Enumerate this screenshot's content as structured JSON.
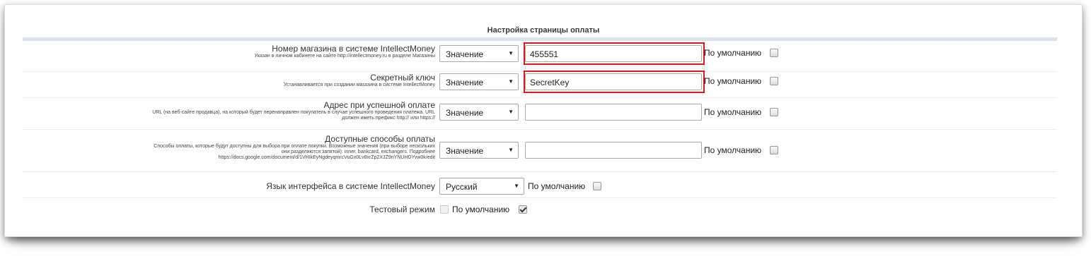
{
  "section": {
    "title": "Настройка страницы оплаты"
  },
  "rows": {
    "shop_id": {
      "label": "Номер магазина в системе IntellectMoney",
      "description": "Указан в личном кабинете на сайте http://intellectmoney.ru в разделе Магазины",
      "select_value": "Значение",
      "input_value": "455551",
      "default_label": "По умолчанию",
      "default_checked": false
    },
    "secret_key": {
      "label": "Секретный ключ",
      "description": "Устанавливается при создании магазина в системе IntellectMoney",
      "select_value": "Значение",
      "input_value": "SecretKey",
      "default_label": "По умолчанию",
      "default_checked": false
    },
    "success_url": {
      "label": "Адрес при успешной оплате",
      "description_lines": [
        "URL (на веб-сайте продавца), на который будет перенаправлен покупатель в случае успешного проведения платежа. URL",
        "должен иметь префикс http:// или https://"
      ],
      "select_value": "Значение",
      "input_value": "",
      "default_label": "По умолчанию",
      "default_checked": false
    },
    "payment_methods": {
      "label": "Доступные способы оплаты",
      "description_lines": [
        "Способы оплаты, которые будут доступны для выбора при оплате покупки. Возможные значения (при выборе нескольких",
        "они разделяются запятой): inner, bankcard, exchangers. Подробнее",
        "https://docs.google.com/document/d/1VHIkEyNgdeyqmrcVuGx0Lv8xrZp2XJZ9nYNUHDYvw0k/edit"
      ],
      "select_value": "Значение",
      "input_value": "",
      "default_label": "По умолчанию",
      "default_checked": false
    },
    "language": {
      "label": "Язык интерфейса в системе IntellectMoney",
      "select_value": "Русский",
      "default_label": "По умолчанию",
      "default_checked": false
    },
    "test_mode": {
      "label": "Тестовый режим",
      "checked": false,
      "default_label": "По умолчанию",
      "default_checked": true
    }
  },
  "icons": {
    "dropdown": "▼"
  },
  "colors": {
    "highlight": "#e0161b",
    "header_line": "#dce3ea"
  }
}
